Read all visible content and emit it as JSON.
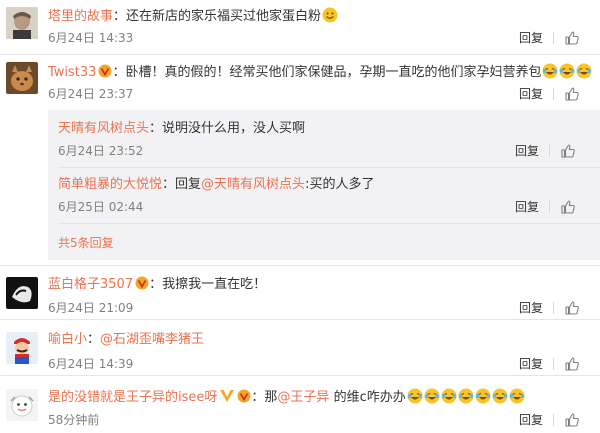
{
  "comments": [
    {
      "user": "塔里的故事",
      "text": "还在新店的家乐福买过他家蛋白粉",
      "time": "6月24日 14:33",
      "reply": "回复",
      "emoji": [
        "grin-emoji"
      ]
    },
    {
      "user": "Twist33",
      "badge": "vip-badge",
      "text": "卧槽！真的假的！经常买他们家保健品，孕期一直吃的他们家孕妇营养包",
      "time": "6月24日 23:37",
      "reply": "回复",
      "emoji": [
        "laugh-cry-emoji",
        "laugh-cry-emoji",
        "laugh-cry-emoji"
      ]
    },
    {
      "user": "蓝白格子3507",
      "badge": "vip-badge",
      "text": "我擦我一直在吃！",
      "time": "6月24日 21:09",
      "reply": "回复"
    },
    {
      "user": "喻白小",
      "text": "@石湖歪嘴李猪王",
      "time": "6月24日 14:39",
      "reply": "回复"
    },
    {
      "user": "是的没错就是王子异的isee呀",
      "badge": "vip-badge",
      "text_prefix": "那",
      "mention": "@王子异",
      "text_suffix": " 的维c咋办办",
      "time": "58分钟前",
      "reply": "回复",
      "emoji": [
        "laugh-cry-emoji",
        "laugh-cry-emoji",
        "laugh-cry-emoji",
        "laugh-cry-emoji",
        "laugh-cry-emoji",
        "laugh-cry-emoji",
        "laugh-cry-emoji"
      ]
    }
  ],
  "sub_replies": [
    {
      "user": "天晴有风树点头",
      "text": "说明没什么用，没人买啊",
      "time": "6月24日 23:52",
      "reply": "回复"
    },
    {
      "user": "简单粗暴的大悦悦",
      "text_prefix": "回复",
      "mention": "@天晴有风树点头",
      "text_suffix": ":买的人多了",
      "time": "6月25日 02:44",
      "reply": "回复"
    }
  ],
  "more_replies": "共5条回复",
  "colors": {
    "username": "#eb7350",
    "text": "#333333",
    "time": "#808080",
    "sub_background": "#f2f2f5",
    "divider": "#e6e6e6"
  }
}
